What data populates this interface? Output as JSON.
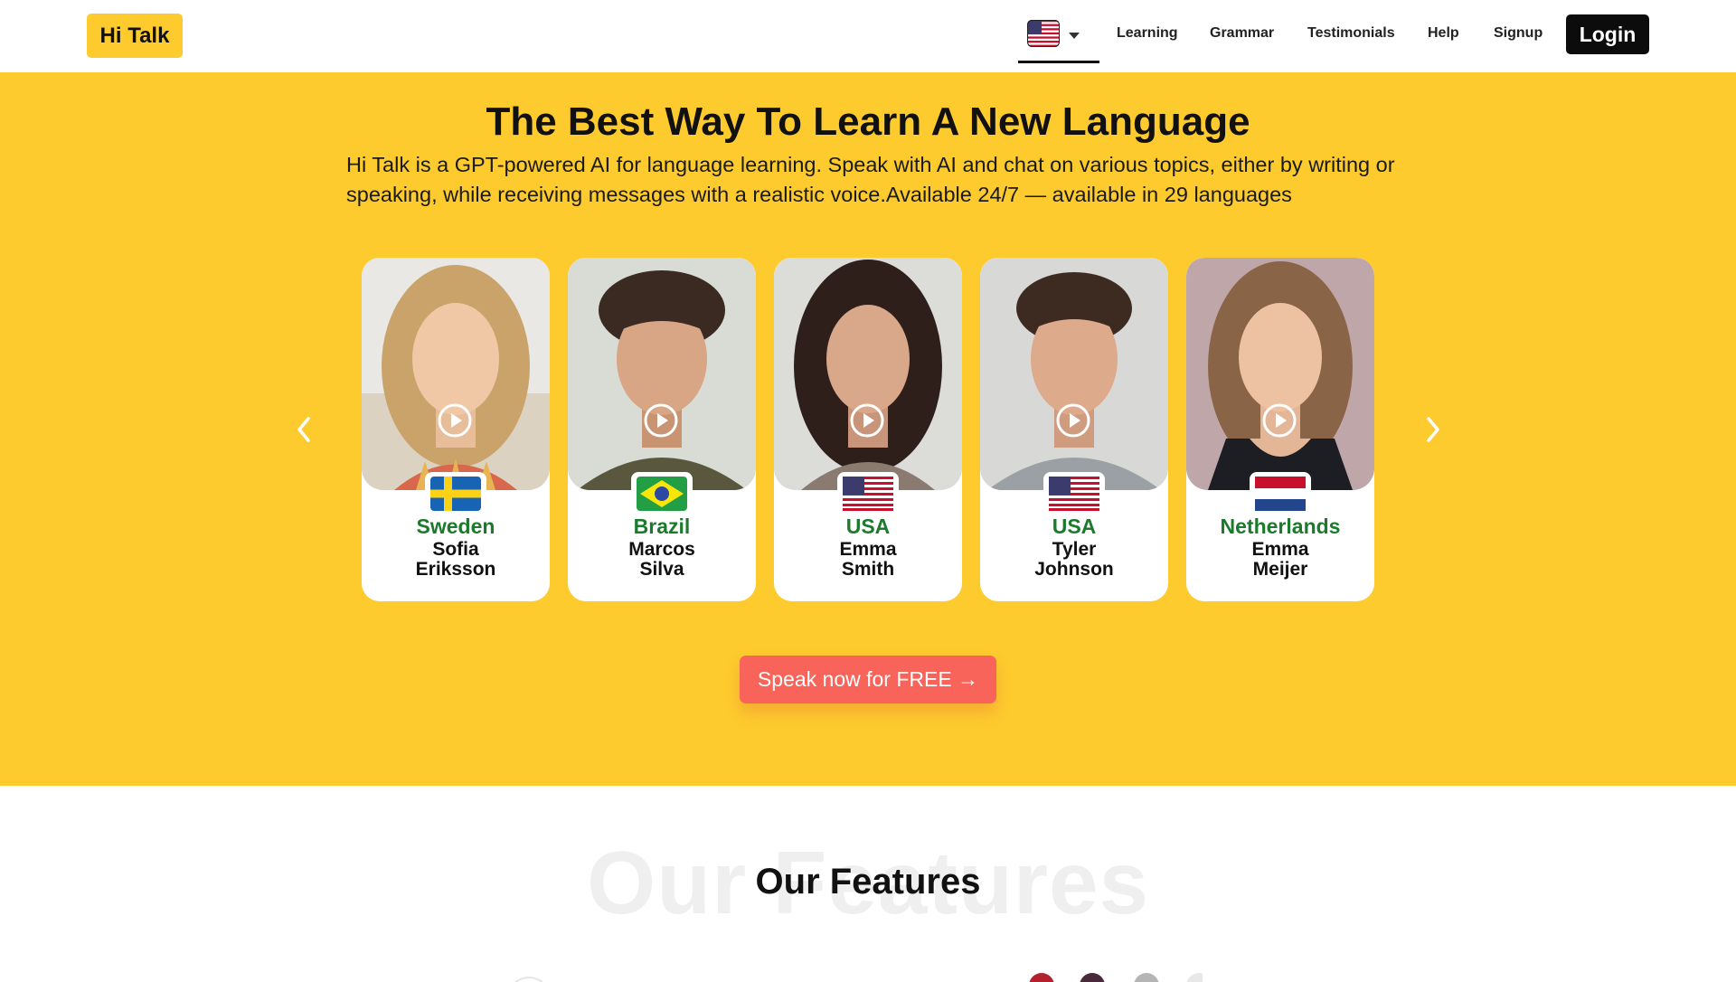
{
  "header": {
    "logo": "Hi Talk",
    "language_flag": "us-flag",
    "nav": [
      "Learning",
      "Grammar",
      "Testimonials",
      "Help",
      "Signup"
    ],
    "login": "Login"
  },
  "hero": {
    "title": "The Best Way To Learn A New Language",
    "subtitle": "Hi Talk is a GPT-powered AI for language learning. Speak with AI and chat on various topics, either by writing or speaking, while receiving messages with a realistic voice.Available 24/7 — available in 29 languages",
    "cta": "Speak now for FREE →",
    "tutors": [
      {
        "country": "Sweden",
        "first": "Sofia",
        "last": "Eriksson",
        "flag": "sweden-flag"
      },
      {
        "country": "Brazil",
        "first": "Marcos",
        "last": "Silva",
        "flag": "brazil-flag"
      },
      {
        "country": "USA",
        "first": "Emma",
        "last": "Smith",
        "flag": "us-flag"
      },
      {
        "country": "USA",
        "first": "Tyler",
        "last": "Johnson",
        "flag": "us-flag"
      },
      {
        "country": "Netherlands",
        "first": "Emma",
        "last": "Meijer",
        "flag": "netherlands-flag"
      }
    ]
  },
  "features": {
    "ghost": "Our Features",
    "title": "Our Features"
  },
  "colors": {
    "brand_yellow": "#fdcb2e",
    "cta_red": "#f8645a",
    "country_green": "#1c7a2c"
  }
}
